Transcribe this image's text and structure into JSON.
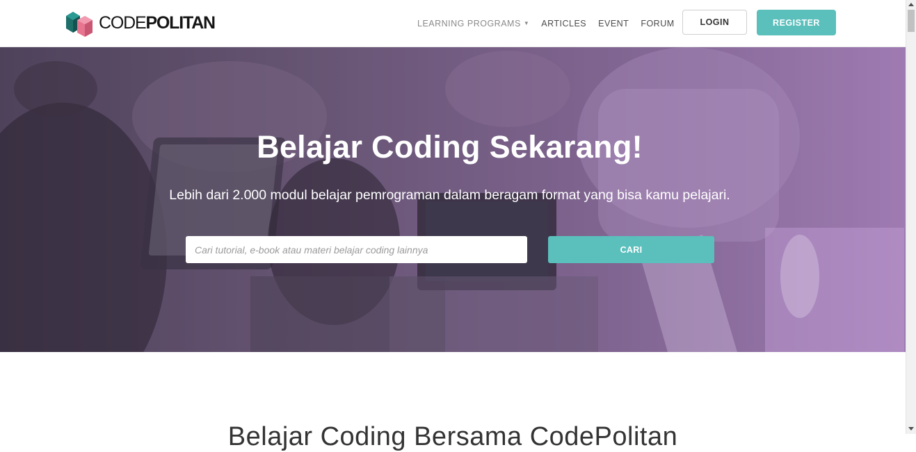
{
  "brand": {
    "name_regular": "CODE",
    "name_bold": "POLITAN",
    "logo_icon": "codepolitan-cube-logo-icon",
    "colors": {
      "teal": "#5bbfbc",
      "pink": "#e8758f",
      "dark_teal": "#1e6f6a"
    }
  },
  "nav": {
    "items": [
      {
        "label": "LEARNING PROGRAMS",
        "has_dropdown": true,
        "icon": "chevron-down-icon"
      },
      {
        "label": "ARTICLES"
      },
      {
        "label": "EVENT"
      },
      {
        "label": "FORUM"
      }
    ],
    "login_label": "LOGIN",
    "register_label": "REGISTER"
  },
  "hero": {
    "title": "Belajar Coding Sekarang!",
    "subtitle": "Lebih dari 2.000 modul belajar pemrograman dalam beragam format yang bisa kamu pelajari.",
    "search": {
      "placeholder": "Cari tutorial, e-book atau materi belajar coding lainnya",
      "value": "",
      "button_label": "CARI"
    },
    "overlay_color": "#9c78b4"
  },
  "section": {
    "heading": "Belajar Coding Bersama CodePolitan"
  }
}
